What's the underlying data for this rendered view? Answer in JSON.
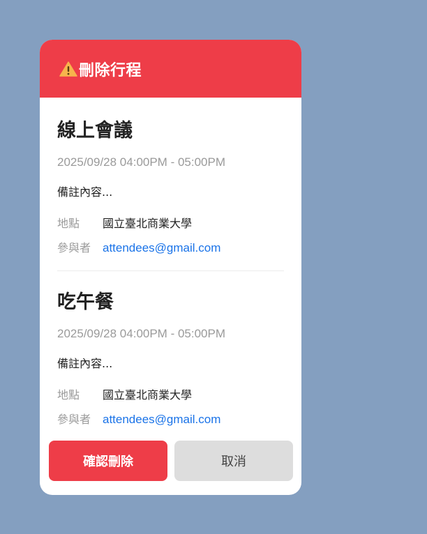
{
  "dialog": {
    "title": "刪除行程",
    "icon": "warning-icon",
    "header_color": "#ee3d48"
  },
  "events": [
    {
      "title": "線上會議",
      "time": "2025/09/28 04:00PM - 05:00PM",
      "note": "備註內容...",
      "location_label": "地點",
      "location": "國立臺北商業大學",
      "attendees_label": "參與者",
      "attendees": "attendees@gmail.com"
    },
    {
      "title": "吃午餐",
      "time": "2025/09/28 04:00PM - 05:00PM",
      "note": "備註內容...",
      "location_label": "地點",
      "location": "國立臺北商業大學",
      "attendees_label": "參與者",
      "attendees": "attendees@gmail.com"
    }
  ],
  "actions": {
    "confirm_label": "確認刪除",
    "cancel_label": "取消"
  },
  "colors": {
    "background": "#849fc0",
    "danger": "#ee3d48",
    "link": "#1a73e8"
  }
}
